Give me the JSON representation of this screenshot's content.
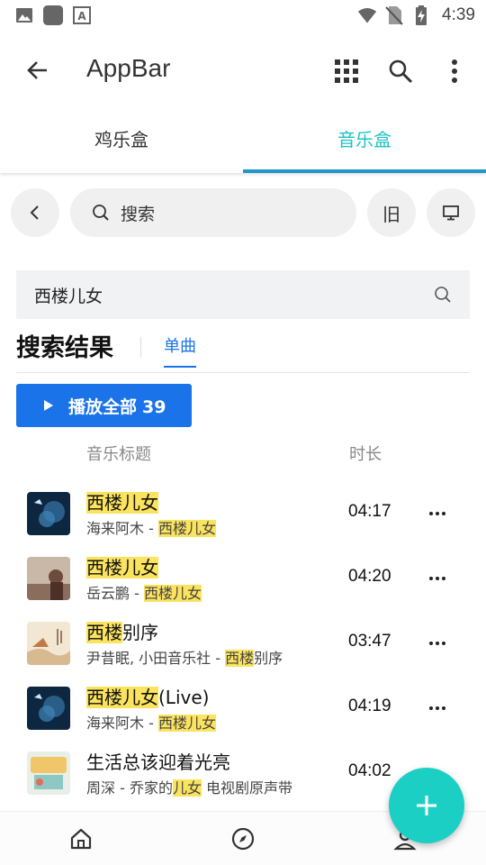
{
  "status_bar": {
    "time": "4:39"
  },
  "app_bar": {
    "title": "AppBar"
  },
  "tabs": [
    {
      "label": "鸡乐盒",
      "active": false
    },
    {
      "label": "音乐盒",
      "active": true
    }
  ],
  "toolbar": {
    "search_label": "搜索",
    "old_label": "旧"
  },
  "query": {
    "value": "西楼儿女"
  },
  "results": {
    "title": "搜索结果",
    "tab": "单曲"
  },
  "play_all": {
    "label": "播放全部",
    "count": "39"
  },
  "columns": {
    "title": "音乐标题",
    "duration": "时长"
  },
  "songs": [
    {
      "title_hl": "西楼儿女",
      "title_rest": "",
      "artist": "海来阿木 - ",
      "album_hl": "西楼儿女",
      "album_rest": "",
      "duration": "04:17"
    },
    {
      "title_hl": "西楼儿女",
      "title_rest": "",
      "artist": "岳云鹏 - ",
      "album_hl": "西楼儿女",
      "album_rest": "",
      "duration": "04:20"
    },
    {
      "title_hl": "西楼",
      "title_rest": "别序",
      "artist": "尹昔眠, 小田音乐社 - ",
      "album_hl": "西楼",
      "album_rest": "别序",
      "duration": "03:47"
    },
    {
      "title_hl": "西楼儿女",
      "title_rest": "(Live)",
      "artist": "海来阿木 - ",
      "album_hl": "西楼儿女",
      "album_rest": "",
      "duration": "04:19"
    },
    {
      "title_hl": "",
      "title_rest": "生活总该迎着光亮",
      "artist": "周深 - 乔家的",
      "album_hl": "儿女",
      "album_rest": " 电视剧原声带",
      "duration": "04:02"
    }
  ],
  "colors": {
    "accent_teal": "#1ec3c3",
    "primary_blue": "#1a73e8",
    "highlight": "#fbe35e",
    "fab": "#1ccfc4"
  }
}
